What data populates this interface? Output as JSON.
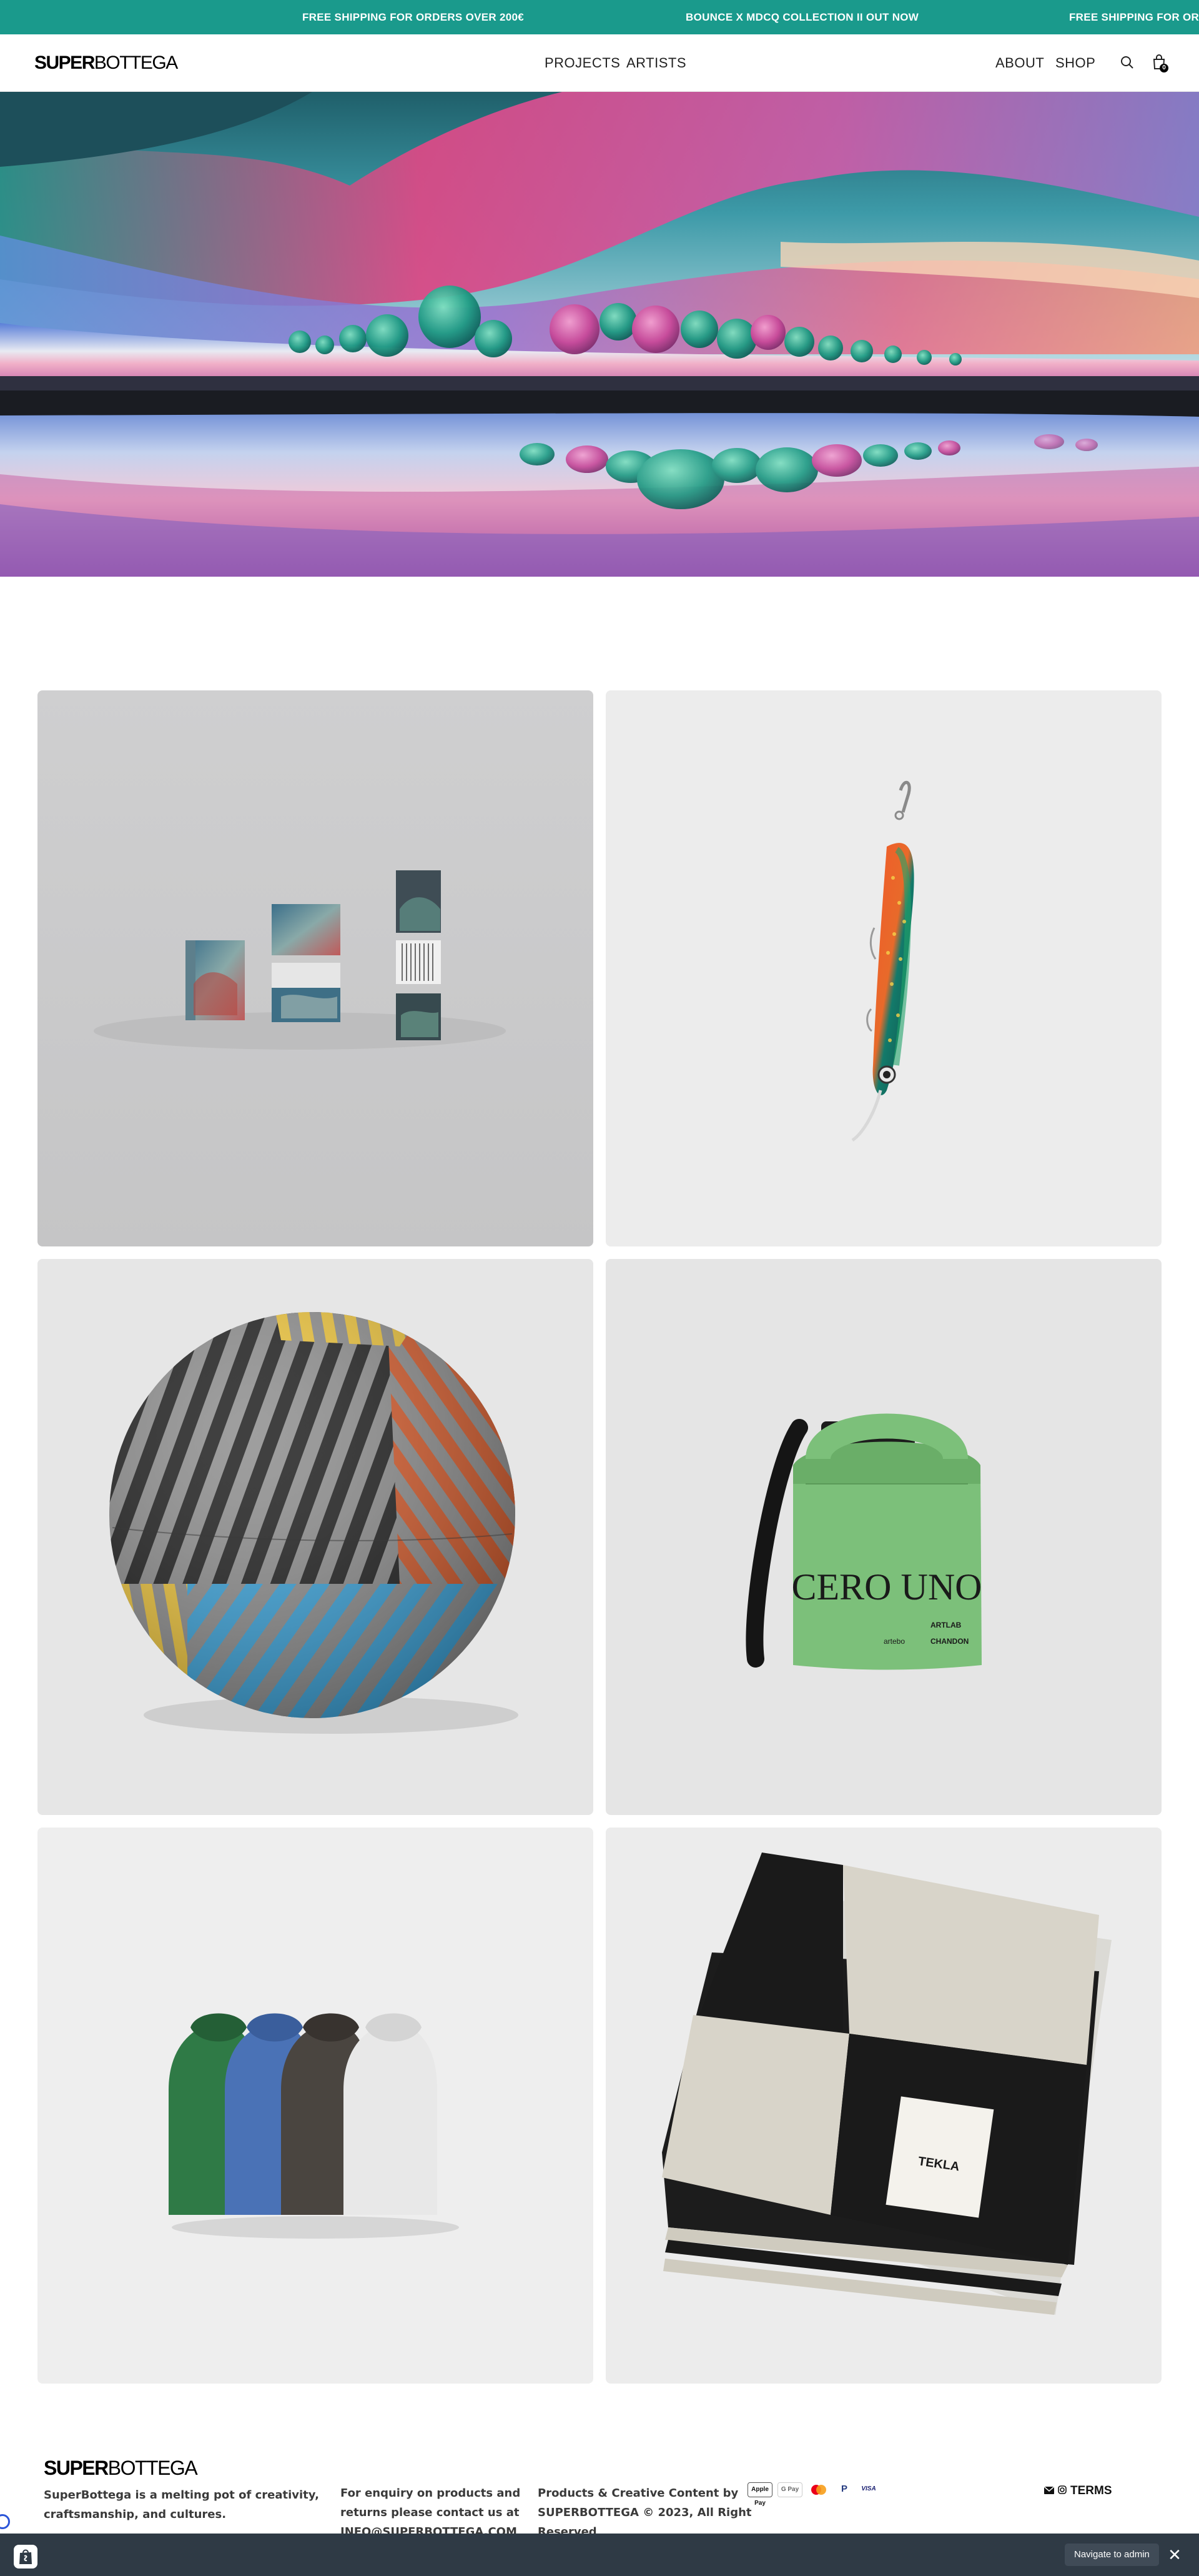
{
  "announcement": {
    "messages": [
      "FREE SHIPPING FOR ORDERS OVER 200€",
      "BOUNCE X MDCQ COLLECTION II OUT NOW",
      "FREE SHIPPING FOR ORDERS OVER 200€"
    ],
    "background": "#1a9a8c"
  },
  "header": {
    "logo_bold": "SUPER",
    "logo_light": "BOTTEGA",
    "nav_left": [
      "PROJECTS",
      "ARTISTS"
    ],
    "nav_right": [
      "ABOUT",
      "SHOP"
    ],
    "search_icon": "search-icon",
    "cart_icon": "shopping-bag-icon",
    "cart_count": "0"
  },
  "hero": {
    "image": "landscape-painting"
  },
  "products": {
    "grid": [
      {
        "image": "boxes-product-mockup"
      },
      {
        "image": "fishing-lure"
      },
      {
        "image": "striped-ball"
      },
      {
        "image": "green-dry-bag"
      },
      {
        "image": "hoodies"
      },
      {
        "image": "tekla-blanket"
      }
    ],
    "bag_print": "CERO UNO",
    "bag_sponsors": [
      "ARTLAB",
      "CHANDON",
      "artebo"
    ],
    "blanket_label": "TEKLA"
  },
  "footer": {
    "logo_bold": "SUPER",
    "logo_light": "BOTTEGA",
    "about_line1": "SuperBottega is a melting pot of creativity,",
    "about_line2": "craftsmanship, and cultures.",
    "enquiry_line1": "For enquiry on products and",
    "enquiry_line2": "returns please contact us at",
    "enquiry_email": "INFO@SUPERBOTTEGA.COM",
    "rights_line1": "Products & Creative Content by",
    "rights_line2": "SUPERBOTTEGA © 2023, All Right",
    "rights_line3": "Reserved",
    "payments": [
      "Apple Pay",
      "G Pay",
      "Mastercard",
      "PayPal",
      "VISA"
    ],
    "terms": "TERMS"
  },
  "admin_bar": {
    "navigate_label": "Navigate to admin",
    "close_label": "✕",
    "background": "#2f3a45"
  }
}
